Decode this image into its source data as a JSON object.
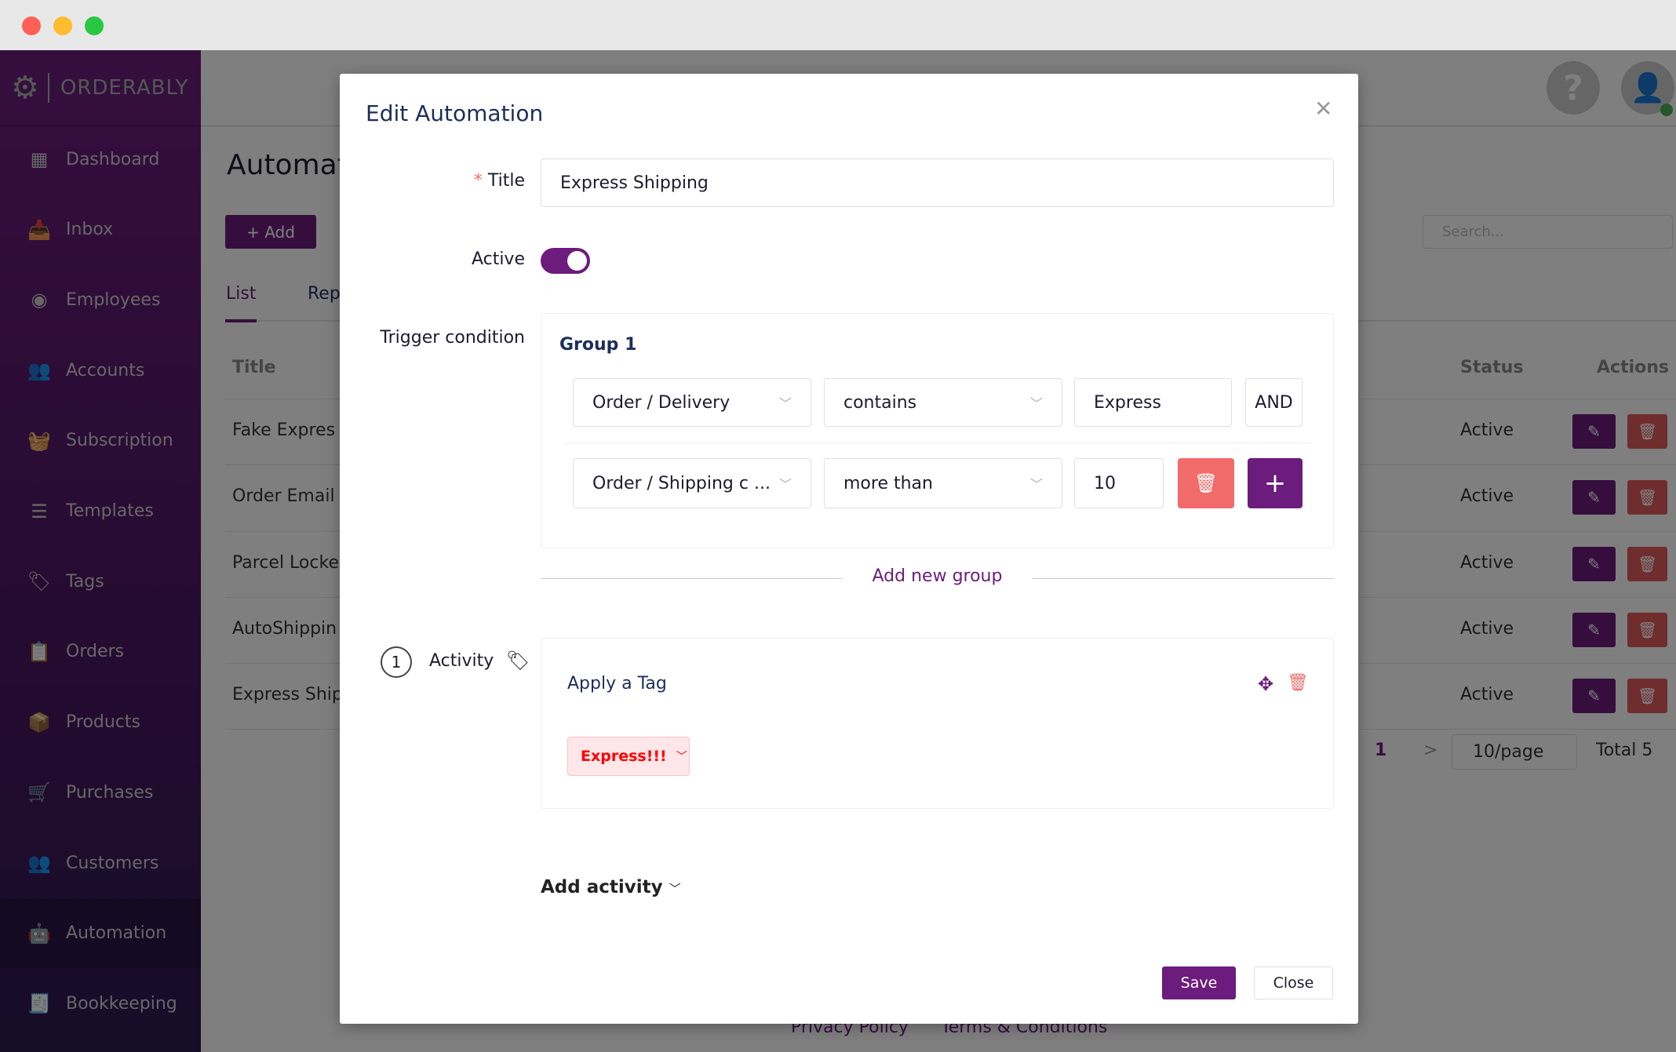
{
  "app": {
    "brand": "ORDERABLY"
  },
  "sidebar": {
    "items": [
      {
        "label": "Dashboard",
        "icon": "dashboard-icon"
      },
      {
        "label": "Inbox",
        "icon": "inbox-icon"
      },
      {
        "label": "Employees",
        "icon": "user-circle-icon"
      },
      {
        "label": "Accounts",
        "icon": "users-icon"
      },
      {
        "label": "Subscription",
        "icon": "basket-icon"
      },
      {
        "label": "Templates",
        "icon": "list-icon"
      },
      {
        "label": "Tags",
        "icon": "tags-icon"
      },
      {
        "label": "Orders",
        "icon": "clipboard-icon"
      },
      {
        "label": "Products",
        "icon": "box-icon"
      },
      {
        "label": "Purchases",
        "icon": "dolly-icon"
      },
      {
        "label": "Customers",
        "icon": "customers-icon"
      },
      {
        "label": "Automation",
        "icon": "robot-icon",
        "active": true
      },
      {
        "label": "Bookkeeping",
        "icon": "file-invoice-icon"
      }
    ]
  },
  "page": {
    "title": "Automat",
    "add_label": "+ Add",
    "tabs": [
      "List",
      "Rep"
    ],
    "search_placeholder": "Search...",
    "columns": {
      "title": "Title",
      "status": "Status",
      "actions": "Actions"
    },
    "rows": [
      {
        "title": "Fake Expres",
        "status": "Active"
      },
      {
        "title": "Order Email",
        "status": "Active"
      },
      {
        "title": "Parcel Locke",
        "status": "Active"
      },
      {
        "title": "AutoShippin",
        "status": "Active"
      },
      {
        "title": "Express Ship",
        "status": "Active"
      }
    ],
    "pagination": {
      "current": "1",
      "next": ">",
      "page_size": "10/page",
      "total": "Total 5"
    },
    "footer": {
      "privacy": "Privacy Policy",
      "terms": "Terms & Conditions"
    }
  },
  "modal": {
    "title": "Edit Automation",
    "title_label": "Title",
    "required_mark": "*",
    "title_value": "Express Shipping",
    "active_label": "Active",
    "active": true,
    "trigger_label": "Trigger condition",
    "group": {
      "name": "Group 1",
      "row1": {
        "field": "Order / Delivery",
        "operator": "contains",
        "value": "Express",
        "joiner": "AND"
      },
      "row2": {
        "field": "Order / Shipping c  ...",
        "operator": "more than",
        "value": "10"
      }
    },
    "add_group": "Add new group",
    "activity": {
      "step": "1",
      "label": "Activity",
      "name": "Apply a Tag",
      "tag": "Express!!!"
    },
    "add_activity": "Add activity",
    "save": "Save",
    "close": "Close"
  },
  "colors": {
    "brand": "#6b1c7c",
    "danger": "#f26b6b",
    "tag_text": "#ff0000",
    "tag_bg": "#ffe6e8"
  }
}
